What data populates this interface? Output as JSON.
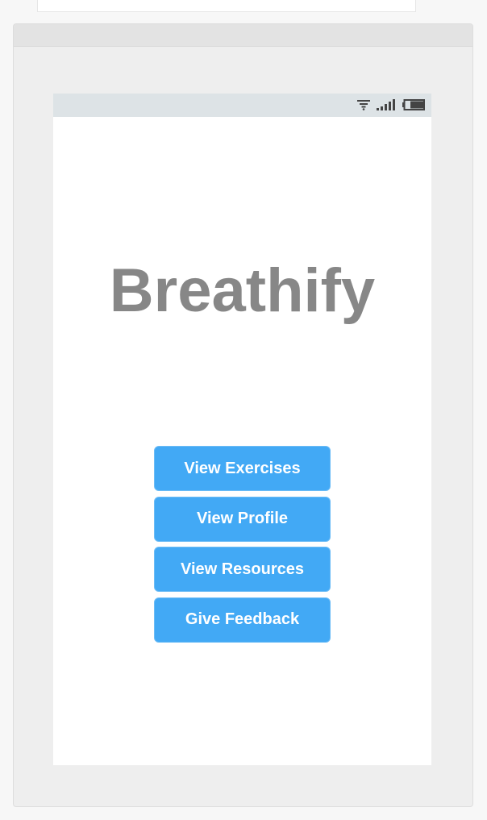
{
  "app": {
    "title": "Breathify"
  },
  "status_bar": {
    "icons": [
      "wifi-icon",
      "signal-icon",
      "battery-icon"
    ]
  },
  "menu": {
    "buttons": [
      {
        "label": "View Exercises"
      },
      {
        "label": "View Profile"
      },
      {
        "label": "View Resources"
      },
      {
        "label": "Give Feedback"
      }
    ]
  },
  "colors": {
    "button_bg": "#42a9f5",
    "title_text": "#878787",
    "status_bar_bg": "#dde3e6",
    "frame_bg": "#eeeeee"
  }
}
